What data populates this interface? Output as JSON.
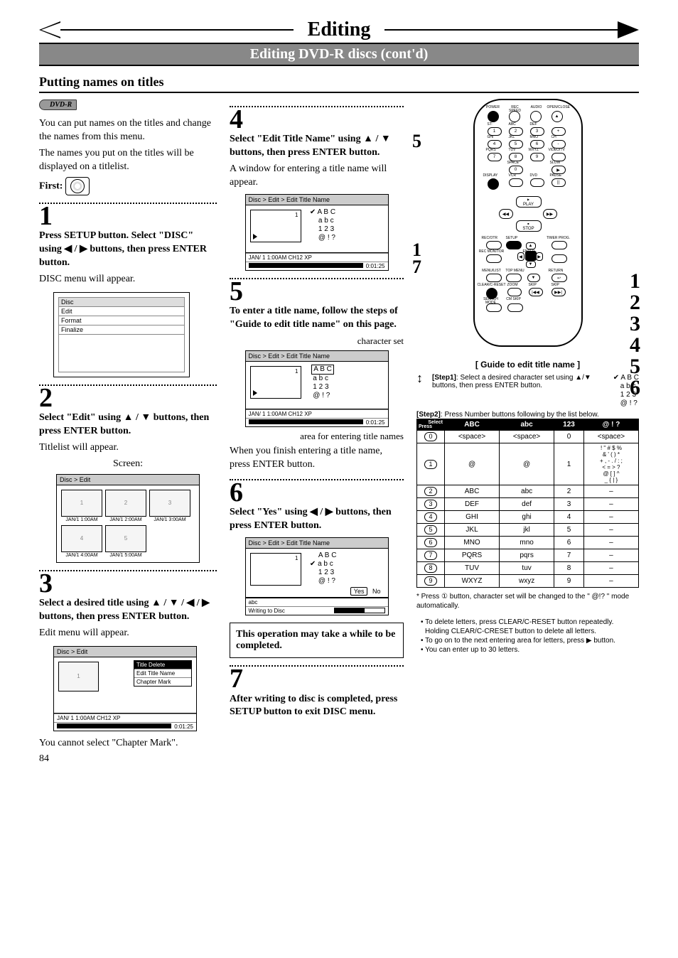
{
  "page": {
    "title": "Editing",
    "subtitle": "Editing DVD-R discs (cont'd)",
    "section": "Putting names on titles",
    "number": "84"
  },
  "left": {
    "badge": "DVD-R",
    "intro1": "You can put names on the titles and change the names from this menu.",
    "intro2": "The names you put on the titles will be displayed on a titlelist.",
    "first": "First:",
    "step1_num": "1",
    "step1_b": "Press SETUP button. Select \"DISC\" using ◀ / ▶ buttons, then press ENTER button.",
    "step1_f": "DISC menu will appear.",
    "disc_menu_header": "Disc",
    "disc_items": [
      "Edit",
      "Format",
      "Finalize"
    ],
    "step2_num": "2",
    "step2_b": "Select \"Edit\" using ▲ / ▼ buttons, then press ENTER button.",
    "step2_f": "Titlelist will appear.",
    "step2_caption": "Screen:",
    "thumb_header": "Disc > Edit",
    "thumbs": [
      "JAN/1  1:00AM",
      "JAN/1  2:00AM",
      "JAN/1  3:00AM",
      "JAN/1  4:00AM",
      "JAN/1  5:00AM"
    ],
    "step3_num": "3",
    "step3_b": "Select a desired title using ▲ / ▼ / ◀ / ▶ buttons, then press ENTER button.",
    "step3_f": "Edit menu will appear.",
    "edit_header": "Disc > Edit",
    "edit_items": [
      "Title Delete",
      "Edit Title Name",
      "Chapter Mark"
    ],
    "edit_footer1": "JAN/ 1   1:00AM  CH12    XP",
    "edit_footer2": "0:01:25",
    "step3_note": "You cannot select \"Chapter Mark\"."
  },
  "mid": {
    "step4_num": "4",
    "step4_b": "Select \"Edit Title Name\" using ▲ / ▼ buttons, then press ENTER button.",
    "step4_f": "A window for entering a title name will appear.",
    "s4_header": "Disc > Edit > Edit Title Name",
    "charset": [
      "A B C",
      "a b c",
      "1 2 3",
      "@ ! ?"
    ],
    "s4_footer1": "JAN/ 1   1:00AM   CH12   XP",
    "s4_footer2": "0:01:25",
    "step5_num": "5",
    "step5_b": "To enter a title name, follow the steps of \"Guide to edit title name\" on this page.",
    "s5_label_charset": "character set",
    "s5_header": "Disc > Edit > Edit Title Name",
    "s5_label_area": "area for entering title names",
    "s5_finish": "When you finish entering a title name, press ENTER button.",
    "step6_num": "6",
    "step6_b": "Select \"Yes\" using ◀ / ▶ buttons, then press ENTER button.",
    "s6_header": "Disc > Edit > Edit Title Name",
    "s6_yes": "Yes",
    "s6_no": "No",
    "s6_abc": "abc",
    "s6_writing": "Writing to Disc",
    "warn": "This operation may take a while to be completed.",
    "step7_num": "7",
    "step7_b": "After writing to disc is completed, press SETUP button to exit DISC menu."
  },
  "right": {
    "side5": "5",
    "side1": "1",
    "side7": "7",
    "side_r": [
      "1",
      "2",
      "3",
      "4",
      "5",
      "6"
    ],
    "remote_labels": {
      "r1": [
        "POWER",
        "REC SPEED",
        "AUDIO",
        "OPEN/CLOSE"
      ],
      "r2": [
        "ST:",
        "ABC",
        "DEF",
        ""
      ],
      "r3": [
        "GHI",
        "JKL",
        "MNO",
        "CH"
      ],
      "r4": [
        "PQRS",
        "TUV",
        "WXYZ",
        "VIDEO/TV"
      ],
      "r5": [
        "",
        "SPACE",
        "",
        "SLOW"
      ],
      "r6": [
        "DISPLAY",
        "VCR",
        "DVD",
        "PAUSE"
      ],
      "play": "PLAY",
      "stop": "STOP",
      "r7": [
        "REC/OTR",
        "SETUP",
        "",
        "TIMER PROG."
      ],
      "r8": [
        "REC MONITOR",
        "",
        "ENTER",
        ""
      ],
      "r9": [
        "MENU/LIST",
        "TOP MENU",
        "",
        "RETURN"
      ],
      "r10": [
        "CLEAR/C-RESET",
        "ZOOM",
        "SKIP",
        "SKIP"
      ],
      "r11": [
        "SEARCH MODE",
        "CM SKIP",
        "",
        ""
      ]
    },
    "guide_title": "[ Guide to edit title name ]",
    "g_step1_label": "[Step1]",
    "g_step1": ": Select a desired character set using ▲/▼ buttons, then press ENTER button.",
    "g_step2_label": "[Step2]",
    "g_step2": ": Press Number buttons following by the list below.",
    "table": {
      "head_select": "Select",
      "head_press": "Press",
      "heads": [
        "ABC",
        "abc",
        "123",
        "@ ! ?"
      ],
      "rows": [
        {
          "k": "0",
          "c": [
            "<space>",
            "<space>",
            "0",
            "<space>"
          ]
        },
        {
          "k": "1",
          "c": [
            "@",
            "@",
            "1",
            "! \" # $ %\n& ' ( ) *\n+ , - . / : ;\n< = > ?\n@ [ ] ^\n_ { | }"
          ]
        },
        {
          "k": "2",
          "c": [
            "ABC",
            "abc",
            "2",
            "–"
          ]
        },
        {
          "k": "3",
          "c": [
            "DEF",
            "def",
            "3",
            "–"
          ]
        },
        {
          "k": "4",
          "c": [
            "GHI",
            "ghi",
            "4",
            "–"
          ]
        },
        {
          "k": "5",
          "c": [
            "JKL",
            "jkl",
            "5",
            "–"
          ]
        },
        {
          "k": "6",
          "c": [
            "MNO",
            "mno",
            "6",
            "–"
          ]
        },
        {
          "k": "7",
          "c": [
            "PQRS",
            "pqrs",
            "7",
            "–"
          ]
        },
        {
          "k": "8",
          "c": [
            "TUV",
            "tuv",
            "8",
            "–"
          ]
        },
        {
          "k": "9",
          "c": [
            "WXYZ",
            "wxyz",
            "9",
            "–"
          ]
        }
      ]
    },
    "note_star": "* Press ① button, character set will be changed to the \" @!? \" mode automatically.",
    "bullets": [
      "To delete letters, press CLEAR/C-RESET button repeatedly. Holding CLEAR/C-CRESET button to delete all letters.",
      "To go on to the next entering area for letters, press ▶ button.",
      "You can enter up to 30 letters."
    ]
  }
}
